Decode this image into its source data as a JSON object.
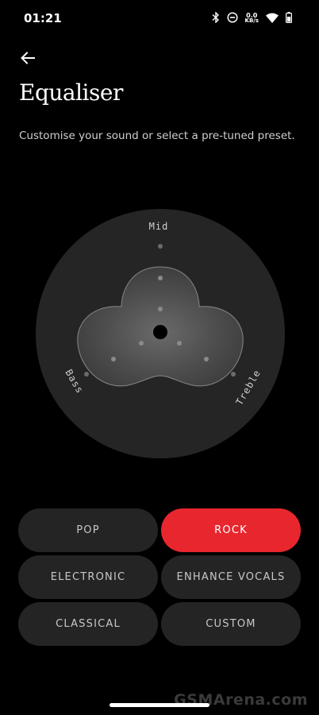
{
  "status_bar": {
    "time": "01:21",
    "net_speed_value": "0.0",
    "net_speed_unit": "KB/s"
  },
  "page": {
    "title": "Equaliser",
    "subtitle": "Customise your sound or select a pre-tuned preset."
  },
  "equaliser": {
    "labels": {
      "mid": "Mid",
      "bass": "Bass",
      "treble": "Treble"
    }
  },
  "presets": [
    {
      "label": "POP",
      "selected": false
    },
    {
      "label": "ROCK",
      "selected": true
    },
    {
      "label": "ELECTRONIC",
      "selected": false
    },
    {
      "label": "ENHANCE VOCALS",
      "selected": false
    },
    {
      "label": "CLASSICAL",
      "selected": false
    },
    {
      "label": "CUSTOM",
      "selected": false
    }
  ],
  "colors": {
    "background": "#000000",
    "accent": "#e8262e",
    "button": "#242424",
    "dial": "#252525"
  },
  "watermark": "GSMArena.com"
}
